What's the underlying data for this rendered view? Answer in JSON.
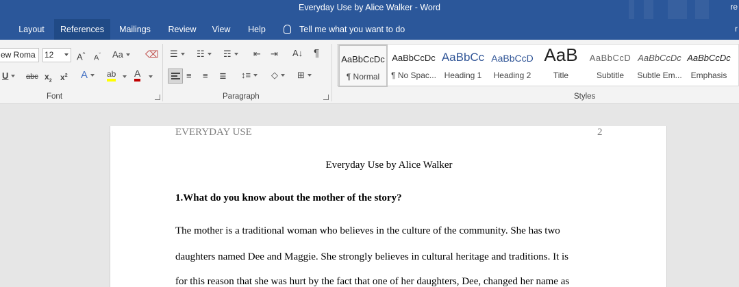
{
  "window": {
    "title": "Everyday Use by Alice Walker  -  Word",
    "user_initial": "re"
  },
  "tabs": [
    {
      "label": "Layout"
    },
    {
      "label": "References"
    },
    {
      "label": "Mailings"
    },
    {
      "label": "Review"
    },
    {
      "label": "View"
    },
    {
      "label": "Help"
    }
  ],
  "tell_me": "Tell me what you want to do",
  "user_initial_tabs": "r",
  "font": {
    "name": "ew Roma",
    "size": "12",
    "group_label": "Font"
  },
  "paragraph": {
    "group_label": "Paragraph"
  },
  "styles": {
    "group_label": "Styles",
    "items": [
      {
        "preview": "AaBbCcDc",
        "label": "¶ Normal"
      },
      {
        "preview": "AaBbCcDc",
        "label": "¶ No Spac..."
      },
      {
        "preview": "AaBbCc",
        "label": "Heading 1"
      },
      {
        "preview": "AaBbCcD",
        "label": "Heading 2"
      },
      {
        "preview": "AaB",
        "label": "Title"
      },
      {
        "preview": "AaBbCcD",
        "label": "Subtitle"
      },
      {
        "preview": "AaBbCcDc",
        "label": "Subtle Em..."
      },
      {
        "preview": "AaBbCcDc",
        "label": "Emphasis"
      }
    ]
  },
  "document": {
    "header_left": "EVERYDAY USE",
    "header_page": "2",
    "title": "Everyday Use by Alice Walker",
    "question": "1.What do you know about the mother of the story?",
    "lines": [
      "The mother is a traditional woman who believes in the culture of the community. She has two",
      "daughters named Dee and Maggie. She strongly believes in cultural heritage and traditions. It is",
      "for this reason that she was hurt by the fact that one of her daughters, Dee, changed her name as"
    ]
  },
  "colors": {
    "ribbon_blue": "#2b579a",
    "active_tab": "#204a86"
  }
}
